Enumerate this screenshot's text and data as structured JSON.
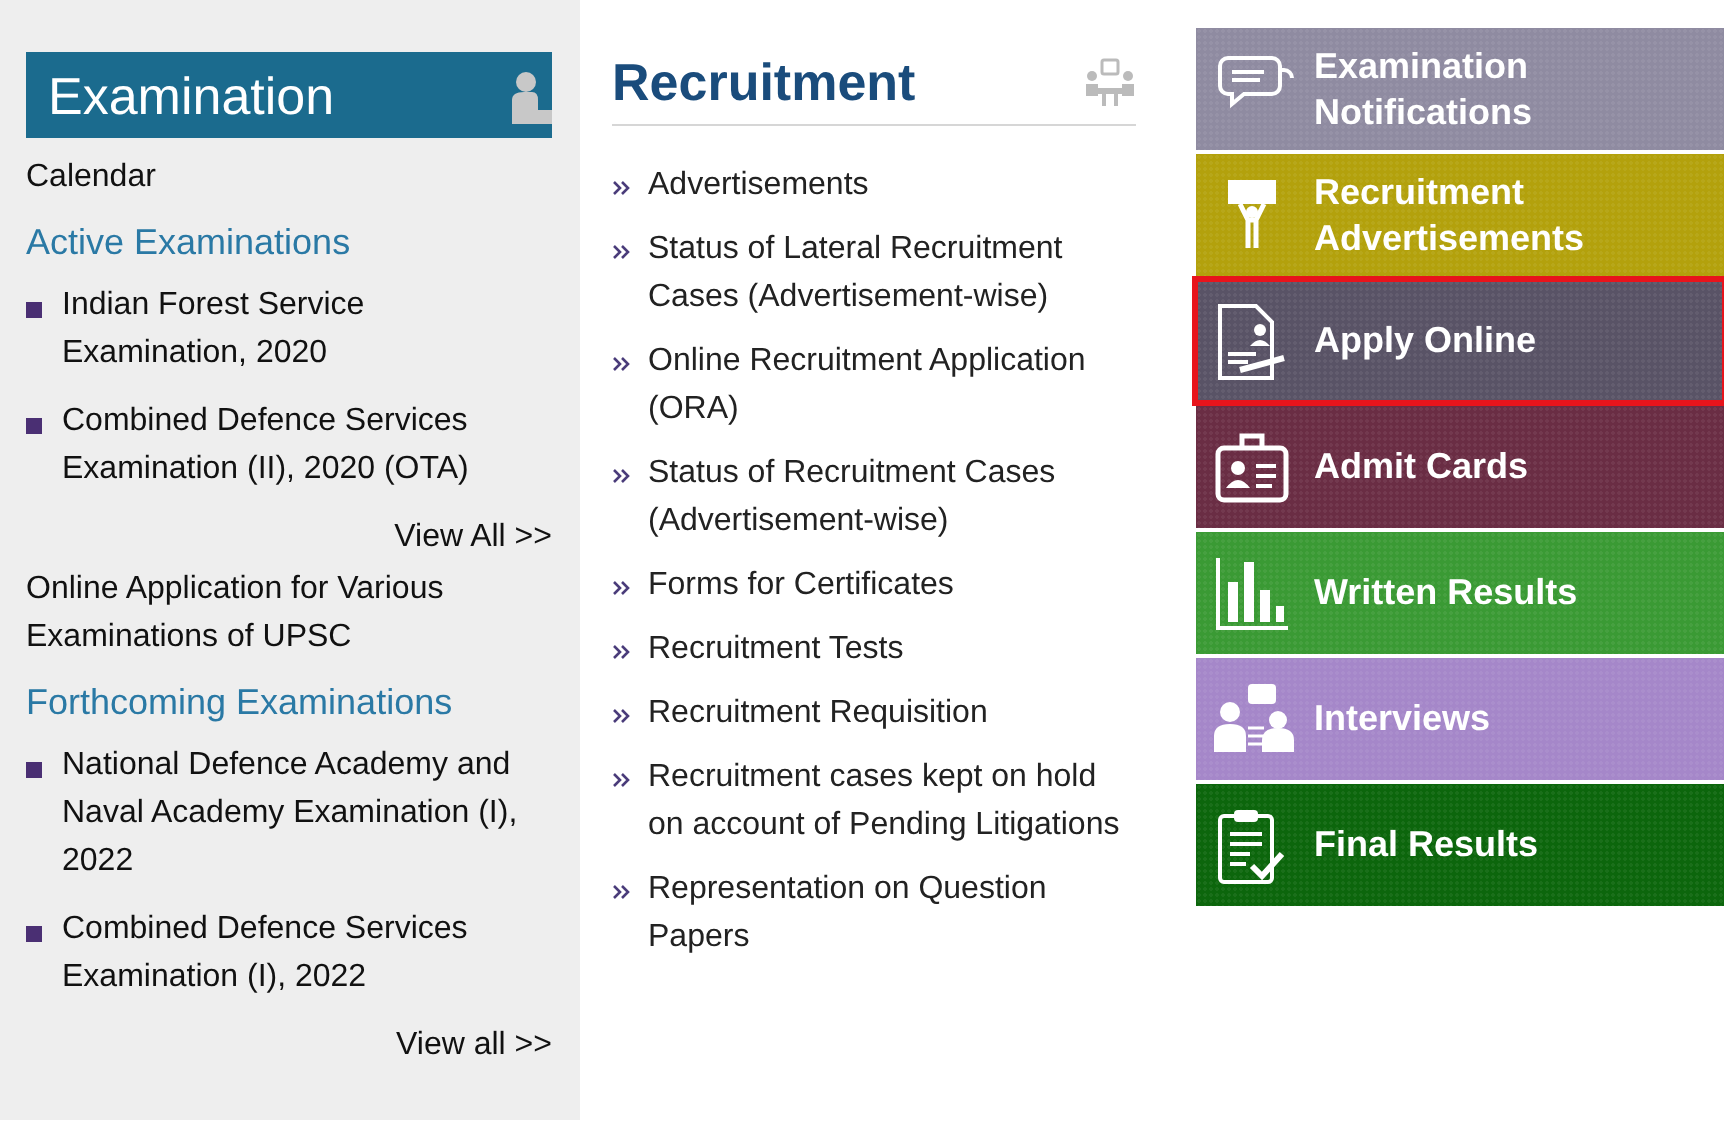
{
  "examination": {
    "title": "Examination",
    "entries": [
      {
        "kind": "link",
        "text": "Calendar"
      },
      {
        "kind": "heading",
        "text": "Active Examinations"
      },
      {
        "kind": "bullet",
        "text": "Indian Forest Service Examination, 2020"
      },
      {
        "kind": "bullet",
        "text": "Combined Defence Services Examination (II), 2020 (OTA)"
      },
      {
        "kind": "more",
        "text": "View All >>"
      },
      {
        "kind": "link",
        "text": "Online Application for Various Examinations of UPSC"
      },
      {
        "kind": "heading",
        "text": "Forthcoming Examinations"
      },
      {
        "kind": "bullet",
        "text": "National Defence Academy and Naval Academy Examination (I), 2022"
      },
      {
        "kind": "bullet",
        "text": "Combined Defence Services Examination (I), 2022"
      },
      {
        "kind": "more",
        "text": "View all >>"
      }
    ]
  },
  "recruitment": {
    "title": "Recruitment",
    "items": [
      "Advertisements",
      "Status of Lateral Recruitment Cases (Advertisement-wise)",
      "Online Recruitment Application (ORA)",
      "Status of Recruitment Cases (Advertisement-wise)",
      "Forms for Certificates",
      "Recruitment Tests",
      "Recruitment Requisition",
      "Recruitment cases kept on hold on account of Pending Litigations",
      "Representation on Question Papers"
    ]
  },
  "tiles": [
    {
      "label": "Examination Notifications",
      "color": "#8f8ba1",
      "highlighted": false
    },
    {
      "label": "Recruitment Advertisements",
      "color": "#b3a10c",
      "highlighted": false
    },
    {
      "label": "Apply Online",
      "color": "#595366",
      "highlighted": true
    },
    {
      "label": "Admit Cards",
      "color": "#6a2d44",
      "highlighted": false
    },
    {
      "label": "Written Results",
      "color": "#3a9a34",
      "highlighted": false
    },
    {
      "label": "Interviews",
      "color": "#a587c9",
      "highlighted": false
    },
    {
      "label": "Final Results",
      "color": "#0c660c",
      "highlighted": false
    }
  ]
}
